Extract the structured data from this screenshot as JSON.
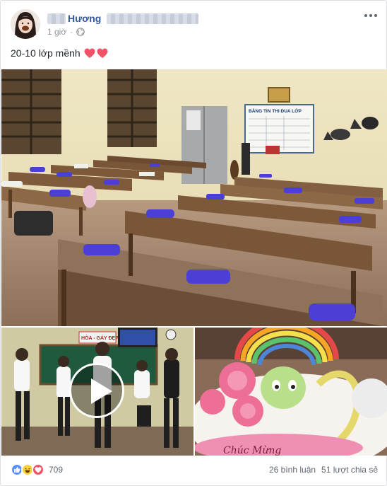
{
  "post": {
    "author": "Hương",
    "time": "1 giờ",
    "caption": "20-10 lớp mềnh"
  },
  "icons": {
    "more": "more-options-icon",
    "privacy": "globe-icon",
    "caption_emoji": "pink-heart-icon",
    "video": "play-icon"
  },
  "photos": {
    "main": {
      "board_title": "BẢNG TIN THI ĐUA LỚP"
    },
    "video_scene": {
      "board_title": "HÒA - GÁY ĐẸP"
    },
    "cake": {
      "inscription": "Chúc Mừng"
    }
  },
  "footer": {
    "reaction_count": "709",
    "comments": "26 bình luận",
    "shares": "51 lượt chia sẻ"
  },
  "colors": {
    "name_link": "#365899",
    "meta_text": "#90949c",
    "like": "#5890ff",
    "haha": "#fcd23f",
    "love": "#f25268",
    "heart": "#f25268"
  }
}
